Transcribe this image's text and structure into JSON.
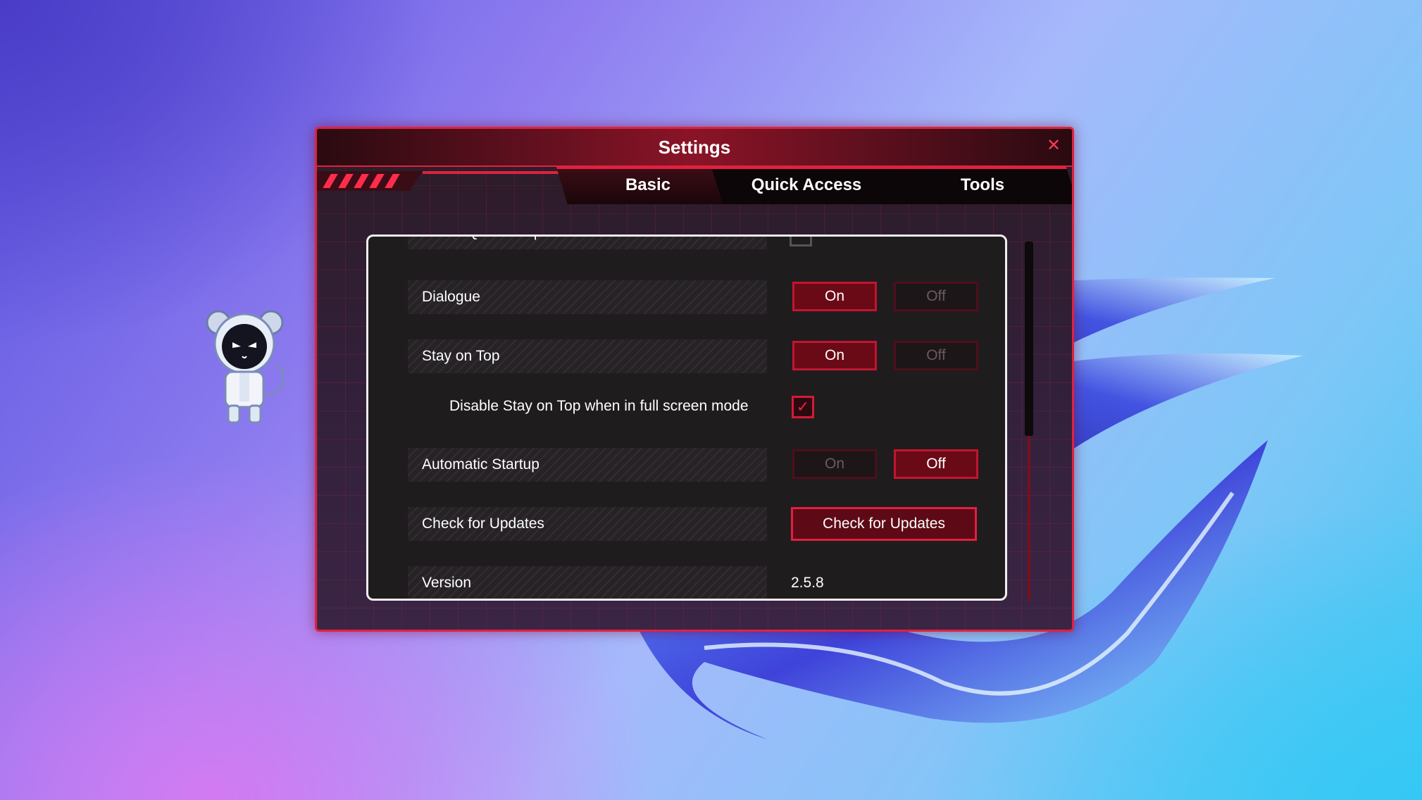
{
  "window": {
    "title": "Settings",
    "close_icon": "close-icon"
  },
  "tabs": [
    {
      "label": "Basic",
      "active": true
    },
    {
      "label": "Quick Access",
      "active": false
    },
    {
      "label": "Tools",
      "active": false
    }
  ],
  "settings": {
    "partial_top": {
      "label": "Action QuickSwap"
    },
    "dialogue": {
      "label": "Dialogue",
      "on": "On",
      "off": "Off",
      "value": "On"
    },
    "stay_on_top": {
      "label": "Stay on Top",
      "on": "On",
      "off": "Off",
      "value": "On"
    },
    "fullscreen_disable": {
      "label": "Disable Stay on Top when in full screen mode",
      "checked": true,
      "check_glyph": "✓"
    },
    "automatic_startup": {
      "label": "Automatic Startup",
      "on": "On",
      "off": "Off",
      "value": "Off"
    },
    "check_updates": {
      "label": "Check for Updates",
      "button": "Check for Updates"
    },
    "version": {
      "label": "Version",
      "value": "2.5.8"
    }
  },
  "colors": {
    "accent": "#e0213f",
    "active_fill": "#6a0a17",
    "panel": "#1f1c1e"
  }
}
